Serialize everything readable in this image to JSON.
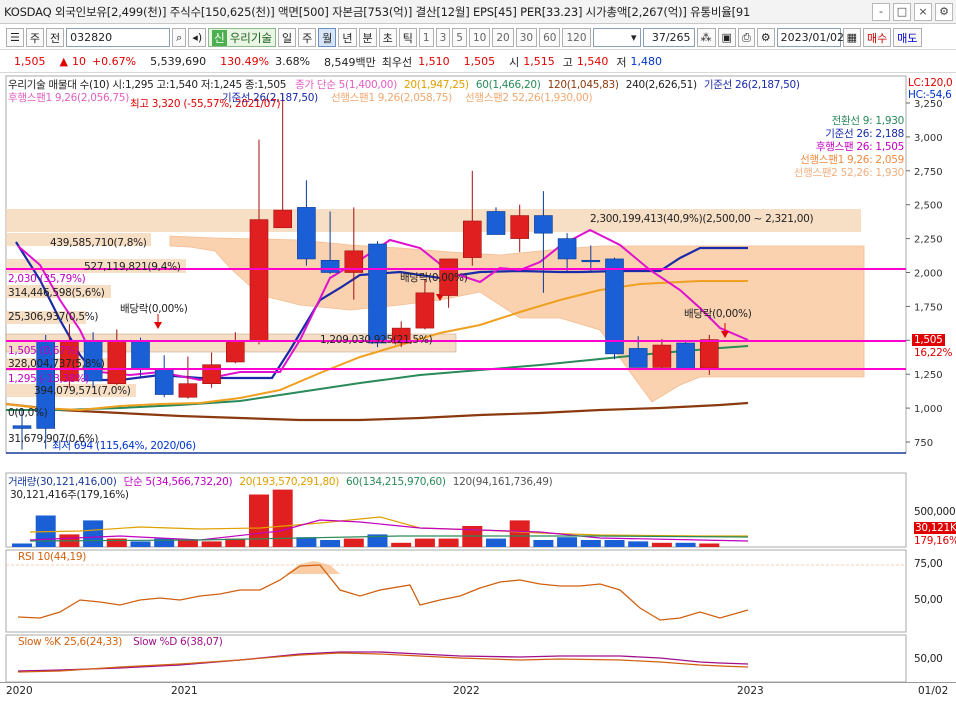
{
  "topbar": {
    "info": "KOSDAQ 외국인보유[2,499(천)] 주식수[150,625(천)] 액면[500] 자본금[753(억)] 결산[12월] EPS[45] PER[33.23] 시가총액[2,267(억)] 유통비율[91",
    "buttons": [
      "-",
      "□",
      "×",
      "⚙"
    ]
  },
  "toolbar": {
    "period": "주",
    "prev": "전",
    "code": "032820",
    "stock_badge": "신",
    "stock_name": "우리기술",
    "tabs": [
      "일",
      "주",
      "월",
      "년",
      "분",
      "초",
      "틱"
    ],
    "selected_tab": "월",
    "numbers": [
      "1",
      "3",
      "5",
      "10",
      "20",
      "30",
      "60",
      "120"
    ],
    "count": "37/265",
    "date": "2023/01/02",
    "buy": "매수",
    "sell": "매도"
  },
  "pricebar": {
    "price": "1,505",
    "change": "10",
    "change_pct": "+0.67%",
    "volume": "5,539,690",
    "vol_ratio": "130.49%",
    "turnover": "3.68%",
    "amount": "8,549백만",
    "best_bid_label": "최우선",
    "best_bid": "1,510",
    "best_ask": "1,505",
    "open_label": "시",
    "open": "1,515",
    "high_label": "고",
    "high": "1,540",
    "low_label": "저",
    "low": "1,480"
  },
  "main_legend": {
    "name": "우리기술 매물대 수(10)  시:1,295 고:1,540 저:1,245 종:1,505",
    "ma5": "종가 단순 5(1,400,00)",
    "ma20": "20(1,947,25)",
    "ma60": "60(1,466,20)",
    "ma120": "120(1,045,83)",
    "ma240": "240(2,626,51)",
    "base": "기준선 26(2,187,50)",
    "lc": "LC:120,0",
    "hc": "HC:-54,6",
    "sub1": "후행스팬1 9,26(2,056,75)",
    "sub_base": "기준선 26(2,187,50)",
    "sub_span1": "선행스팬1 9,26(2,058,75)",
    "sub_span2": "선행스팬2 52,26(1,930,00)",
    "max_note": "최고 3,320 (-55,57%, 2021/07)",
    "min_note": "최저 694 (115,64%, 2020/06)"
  },
  "ichimoku_box": {
    "conv": "전환선 9: 1,930",
    "base": "기준선 26: 2,188",
    "lag": "후행스팬 26: 1,505",
    "lead1": "선행스팬1 9,26: 2,059",
    "lead2": "선행스팬2 52,26: 1,930"
  },
  "volume_profile": {
    "labels": [
      "2,300,199,413(40,9%)(2,500,00 ~ 2,321,00)",
      "439,585,710(7,8%)",
      "527,119,821(9,4%)",
      "314,446,598(5,6%)",
      "25,306,937(0,5%)",
      "1,209,030,925(21,5%)",
      "328,004,737(5,8%)",
      "394,079,571(7,0%)",
      "0(0,0%)",
      "31,679,907(0,6%)"
    ],
    "side_notes": [
      "2,030 (35,79%)",
      "1,505 (0,67%)",
      "1,295 (-13,38%)"
    ]
  },
  "dividend_labels": [
    "배당락(0,00%)",
    "배당락(0,00%)",
    "배당락(0,00%)"
  ],
  "price_axis": [
    "3,250",
    "3,000",
    "2,750",
    "2,500",
    "2,250",
    "2,000",
    "1,750",
    "1,500",
    "1,250",
    "1,000",
    "750"
  ],
  "price_tags": {
    "current": "1,505",
    "pct": "16,22%"
  },
  "volume_pane": {
    "legend_title": "거래량(30,121,416,00)",
    "ma5": "단순 5(34,566,732,20)",
    "ma20": "20(193,570,291,80)",
    "ma60": "60(134,215,970,60)",
    "ma120": "120(94,161,736,49)",
    "current": "30,121,416주(179,16%)",
    "axis": [
      "500,000"
    ],
    "tag": "30,121K",
    "tag_pct": "179,16%"
  },
  "rsi_pane": {
    "legend": "RSI 10(44,19)",
    "axis": [
      "75,00",
      "50,00"
    ]
  },
  "slow_pane": {
    "legend_k": "Slow %K 25,6(24,33)",
    "legend_d": "Slow %D 6(38,07)",
    "axis": [
      "50,00"
    ]
  },
  "x_axis": [
    "2020",
    "2021",
    "2022",
    "2023",
    "01/02"
  ],
  "chart_data": {
    "type": "candlestick",
    "candles": [
      {
        "o": 870,
        "h": 1000,
        "l": 694,
        "c": 850
      },
      {
        "o": 1500,
        "h": 1540,
        "l": 700,
        "c": 850
      },
      {
        "o": 1200,
        "h": 1620,
        "l": 1150,
        "c": 1490
      },
      {
        "o": 1490,
        "h": 1560,
        "l": 1150,
        "c": 1200
      },
      {
        "o": 1180,
        "h": 1580,
        "l": 1170,
        "c": 1500
      },
      {
        "o": 1500,
        "h": 1520,
        "l": 1230,
        "c": 1290
      },
      {
        "o": 1290,
        "h": 1390,
        "l": 1080,
        "c": 1100
      },
      {
        "o": 1080,
        "h": 1380,
        "l": 1070,
        "c": 1180
      },
      {
        "o": 1180,
        "h": 1410,
        "l": 1150,
        "c": 1320
      },
      {
        "o": 1340,
        "h": 1560,
        "l": 1330,
        "c": 1490
      },
      {
        "o": 1490,
        "h": 2980,
        "l": 1470,
        "c": 2390
      },
      {
        "o": 2330,
        "h": 3320,
        "l": 2330,
        "c": 2460
      },
      {
        "o": 2480,
        "h": 2680,
        "l": 2050,
        "c": 2100
      },
      {
        "o": 2090,
        "h": 2450,
        "l": 1990,
        "c": 2000
      },
      {
        "o": 2000,
        "h": 2480,
        "l": 1800,
        "c": 2160
      },
      {
        "o": 2210,
        "h": 2230,
        "l": 1450,
        "c": 1480
      },
      {
        "o": 1480,
        "h": 1640,
        "l": 1450,
        "c": 1590
      },
      {
        "o": 1590,
        "h": 1950,
        "l": 1580,
        "c": 1850
      },
      {
        "o": 1830,
        "h": 2100,
        "l": 1740,
        "c": 2100
      },
      {
        "o": 2110,
        "h": 2750,
        "l": 2050,
        "c": 2380
      },
      {
        "o": 2450,
        "h": 2480,
        "l": 2300,
        "c": 2280
      },
      {
        "o": 2250,
        "h": 2500,
        "l": 2150,
        "c": 2420
      },
      {
        "o": 2420,
        "h": 2600,
        "l": 1850,
        "c": 2290
      },
      {
        "o": 2250,
        "h": 2290,
        "l": 2010,
        "c": 2100
      },
      {
        "o": 2090,
        "h": 2200,
        "l": 2000,
        "c": 2080
      },
      {
        "o": 2100,
        "h": 2110,
        "l": 1360,
        "c": 1400
      },
      {
        "o": 1440,
        "h": 1530,
        "l": 1300,
        "c": 1300
      },
      {
        "o": 1300,
        "h": 1510,
        "l": 1290,
        "c": 1465
      },
      {
        "o": 1480,
        "h": 1500,
        "l": 1290,
        "c": 1290
      },
      {
        "o": 1295,
        "h": 1540,
        "l": 1245,
        "c": 1505
      }
    ]
  }
}
